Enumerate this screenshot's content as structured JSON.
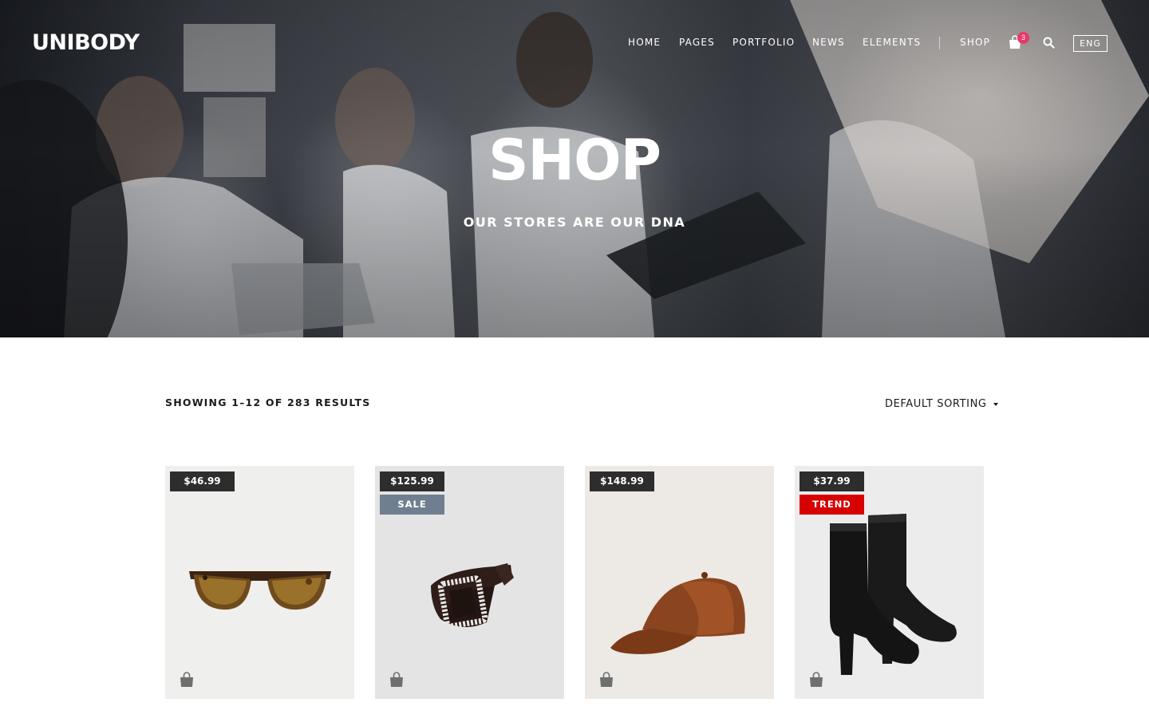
{
  "brand": {
    "logo": "UNIBODY"
  },
  "nav": {
    "items": [
      "HOME",
      "PAGES",
      "PORTFOLIO",
      "NEWS",
      "ELEMENTS",
      "SHOP"
    ],
    "cart_count": "3",
    "language": "ENG"
  },
  "hero": {
    "title": "SHOP",
    "subtitle": "OUR STORES ARE OUR DNA"
  },
  "toolbar": {
    "results_text": "SHOWING 1–12 OF 283 RESULTS",
    "sorting_label": "DEFAULT SORTING"
  },
  "products": [
    {
      "price": "$46.99",
      "badge": "",
      "item": "sunglasses",
      "background": "#efefed"
    },
    {
      "price": "$125.99",
      "badge": "SALE",
      "badge_color": "#6f7f8f",
      "item": "belt",
      "background": "#e4e4e4"
    },
    {
      "price": "$148.99",
      "badge": "",
      "item": "cap",
      "background": "#ede9e4"
    },
    {
      "price": "$37.99",
      "badge": "TREND",
      "badge_color": "#d60000",
      "item": "boots",
      "background": "#ececec"
    }
  ],
  "icons": {
    "cart": "shopping-bag-icon",
    "search": "search-icon",
    "add_to_cart": "shopping-bag-icon",
    "sort": "caret-down-icon"
  },
  "colors": {
    "price_tag": "#2d2d2d",
    "cart_badge": "#e83867",
    "sale_badge": "#6f7f8f",
    "trend_badge": "#d60000"
  }
}
